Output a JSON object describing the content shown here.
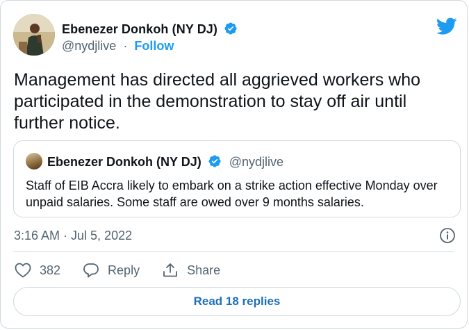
{
  "author": {
    "name": "Ebenezer Donkoh (NY DJ)",
    "handle": "@nydjlive",
    "separator": "·",
    "follow_label": "Follow"
  },
  "tweet": {
    "text": "Management has directed all aggrieved workers who participated in the demonstration to stay off air until further notice.",
    "timestamp": "3:16 AM · Jul 5, 2022"
  },
  "quoted_tweet": {
    "author_name": "Ebenezer Donkoh (NY DJ)",
    "handle": "@nydjlive",
    "text": "Staff of EIB Accra likely to embark on a strike action effective Monday over unpaid salaries. Some staff are owed over 9 months salaries."
  },
  "actions": {
    "like_count": "382",
    "reply_label": "Reply",
    "share_label": "Share"
  },
  "read_replies_label": "Read 18 replies",
  "colors": {
    "accent": "#1d9bf0",
    "muted": "#536471",
    "text": "#0f1419",
    "border": "#cfd9de"
  },
  "icons": [
    "twitter-logo-icon",
    "verified-badge-icon",
    "info-icon",
    "heart-icon",
    "reply-icon",
    "share-icon"
  ]
}
